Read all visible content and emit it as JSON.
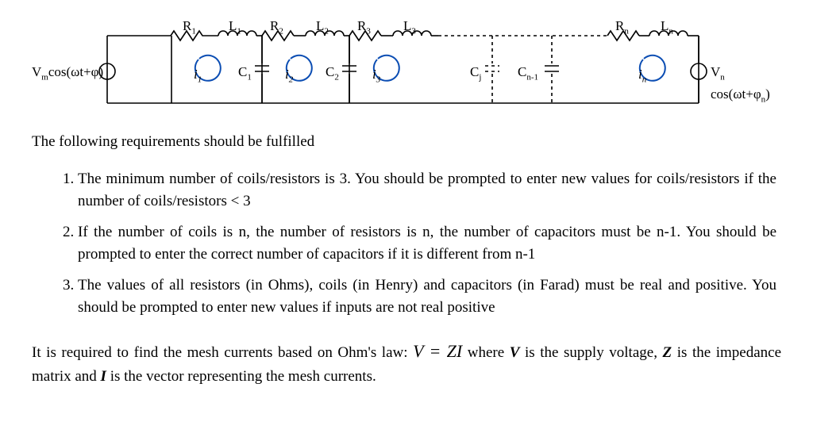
{
  "circuit": {
    "source_left": "V<sub class='sub'>m</sub>cos(ωt+φ)",
    "source_right": "V<sub class='sub'>n</sub> cos(ωt+φ<sub class='sub'>n</sub>)",
    "R": [
      "R<sub class='sub'>1</sub>",
      "R<sub class='sub'>2</sub>",
      "R<sub class='sub'>3</sub>",
      "R<sub class='sub'>n</sub>"
    ],
    "L": [
      "L<sub class='sub'>1</sub>",
      "L<sub class='sub'>2</sub>",
      "L<sub class='sub'>3</sub>",
      "L<sub class='sub'>n</sub>"
    ],
    "C": [
      "C<sub class='sub'>1</sub>",
      "C<sub class='sub'>2</sub>",
      "C<sub class='sub'>j</sub>",
      "C<sub class='sub'>n-1</sub>"
    ],
    "i": [
      "i<sub class='sub'>1</sub>",
      "i<sub class='sub'>2</sub>",
      "i<sub class='sub'>3</sub>",
      "i<sub class='sub'>n</sub>"
    ]
  },
  "intro": "The following requirements should be fulfilled",
  "req1": "The minimum number of coils/resistors is 3. You should be prompted to enter new values for coils/resistors if the number of coils/resistors < 3",
  "req2": "If the number of coils is n, the number of resistors is n, the number of capacitors must be n-1. You should be prompted to enter the correct number of capacitors if it is different from n-1",
  "req3": "The values of all resistors (in Ohms), coils (in Henry) and capacitors (in Farad) must be real and positive. You should be prompted to enter new values if inputs are not real positive",
  "closing_pre": "It is required to find the mesh currents based on Ohm's law: ",
  "equation": "V = ZI",
  "closing_post_a": " where ",
  "closing_V": "V",
  "closing_post_b": " is the supply voltage, ",
  "closing_Z": "Z",
  "closing_post_c": " is the impedance matrix and ",
  "closing_I": "I",
  "closing_post_d": " is the vector representing the mesh currents."
}
